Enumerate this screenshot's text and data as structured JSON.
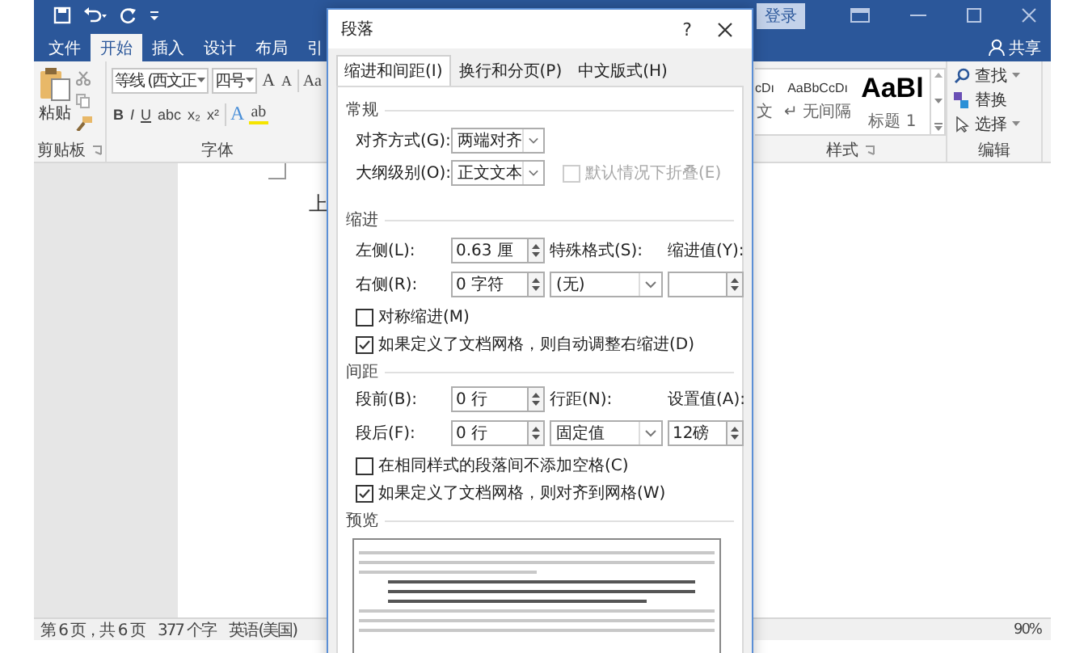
{
  "word": {
    "title_bar": {
      "login": "登录"
    },
    "tabs": [
      {
        "label": "文件",
        "selected": false
      },
      {
        "label": "开始",
        "selected": true
      },
      {
        "label": "插入",
        "selected": false
      },
      {
        "label": "设计",
        "selected": false
      },
      {
        "label": "布局",
        "selected": false
      },
      {
        "label": "引",
        "selected": false
      }
    ],
    "share": "共享",
    "clipboard": {
      "paste": "粘贴",
      "group": "剪贴板"
    },
    "font": {
      "name": "等线 (西文正",
      "size": "四号",
      "grow": "A",
      "shrink": "A",
      "case": "Aa",
      "formats": [
        "B",
        "I",
        "U",
        "abc",
        "x₂",
        "x²"
      ],
      "color_letter": "A",
      "highlight": "ab",
      "group": "字体"
    },
    "styles": {
      "items": [
        {
          "sample": "cDı",
          "name": "文",
          "kind": "normal"
        },
        {
          "sample": "AaBbCcDı",
          "name": "↵ 无间隔",
          "kind": "normal"
        },
        {
          "sample": "AaBl",
          "name": "标题 1",
          "kind": "heading"
        }
      ],
      "group": "样式"
    },
    "editing": {
      "items": [
        {
          "kind": "find",
          "label": "查找",
          "dropdown": true
        },
        {
          "kind": "replace",
          "label": "替换",
          "dropdown": false
        },
        {
          "kind": "select",
          "label": "选择",
          "dropdown": true
        }
      ],
      "group": "编辑"
    },
    "document": {
      "text": "上"
    },
    "status_bar": {
      "items": [
        "第 6 页，共 6 页",
        "377 个字",
        "英语(美国)"
      ],
      "zoom": "90%"
    }
  },
  "dialog": {
    "title": "段落",
    "help": "?",
    "tabs": [
      {
        "label": "缩进和间距(I)",
        "selected": true
      },
      {
        "label": "换行和分页(P)",
        "selected": false
      },
      {
        "label": "中文版式(H)",
        "selected": false
      }
    ],
    "general": {
      "heading": "常规",
      "alignment": {
        "label": "对齐方式(G):",
        "value": "两端对齐"
      },
      "outline": {
        "label": "大纲级别(O):",
        "value": "正文文本"
      },
      "collapse": {
        "label": "默认情况下折叠(E)",
        "checked": false,
        "disabled": true
      }
    },
    "indent": {
      "heading": "缩进",
      "left": {
        "label": "左侧(L):",
        "value": "0.63 厘"
      },
      "right": {
        "label": "右侧(R):",
        "value": "0 字符"
      },
      "special": {
        "label": "特殊格式(S):",
        "value": "(无)"
      },
      "by": {
        "label": "缩进值(Y):"
      },
      "checkboxes": [
        {
          "label": "对称缩进(M)",
          "checked": false,
          "disabled": false
        },
        {
          "label": "如果定义了文档网格，则自动调整右缩进(D)",
          "checked": true,
          "disabled": false
        }
      ]
    },
    "spacing": {
      "heading": "间距",
      "before": {
        "label": "段前(B):",
        "value": "0 行"
      },
      "after": {
        "label": "段后(F):",
        "value": "0 行"
      },
      "line": {
        "label": "行距(N):",
        "value": "固定值"
      },
      "at": {
        "label": "设置值(A):",
        "value": "12磅"
      },
      "checkboxes": [
        {
          "label": "在相同样式的段落间不添加空格(C)",
          "checked": false,
          "disabled": false
        },
        {
          "label": "如果定义了文档网格，则对齐到网格(W)",
          "checked": true,
          "disabled": false
        }
      ]
    },
    "preview": {
      "heading": "预览"
    }
  }
}
